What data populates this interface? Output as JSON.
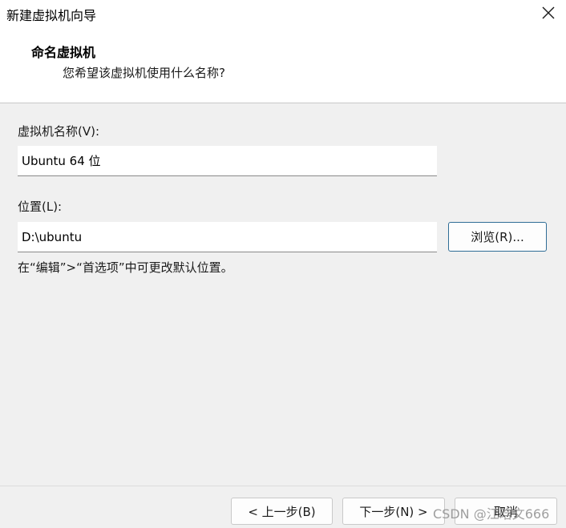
{
  "window": {
    "title": "新建虚拟机向导",
    "close_icon": "close-icon"
  },
  "header": {
    "heading": "命名虚拟机",
    "subheading": "您希望该虚拟机使用什么名称?"
  },
  "form": {
    "vm_name_label": "虚拟机名称(V):",
    "vm_name_value": "Ubuntu 64 位",
    "location_label": "位置(L):",
    "location_value": "D:\\ubuntu",
    "browse_label": "浏览(R)...",
    "hint": "在“编辑”>“首选项”中可更改默认位置。"
  },
  "footer": {
    "back_label": "< 上一步(B)",
    "next_label": "下一步(N) >",
    "cancel_label": "取消"
  },
  "watermark": "CSDN @江晗文666",
  "colors": {
    "header_bg": "#ffffff",
    "body_bg": "#f0f0f0",
    "accent_border": "#2f6d96"
  }
}
